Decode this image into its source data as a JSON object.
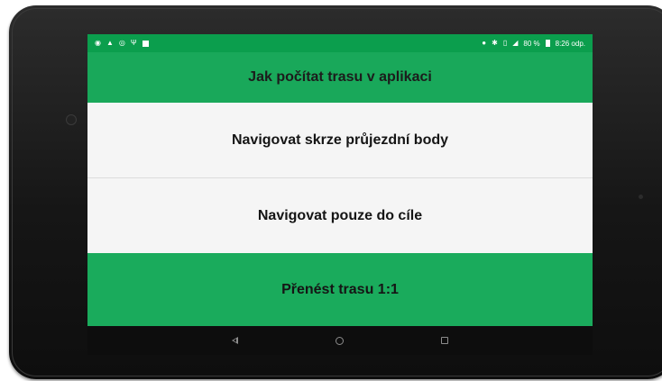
{
  "status_bar": {
    "left_icons": [
      "eye-icon",
      "warning-icon",
      "sync-icon",
      "usb-icon",
      "image-icon"
    ],
    "right_icons": [
      "location-icon",
      "bluetooth-icon",
      "vibrate-icon",
      "signal-icon",
      "battery-icon"
    ],
    "battery": "80 %",
    "time": "8:26 odp."
  },
  "header": {
    "title": "Jak počítat trasu v aplikaci"
  },
  "options": {
    "waypoints": "Navigovat skrze průjezdní body",
    "destination_only": "Navigovat pouze do cíle",
    "transfer": "Přenést trasu 1:1"
  },
  "nav_bar": {
    "icons": [
      "back-icon",
      "home-icon",
      "recents-icon"
    ]
  },
  "colors": {
    "status_bar": "#0b9e4d",
    "header": "#19a85a",
    "option_light": "#f5f5f5",
    "option_green": "#1aab5c",
    "nav_bar": "#0d0d0d",
    "device_bezel": "#1a1a1a"
  }
}
